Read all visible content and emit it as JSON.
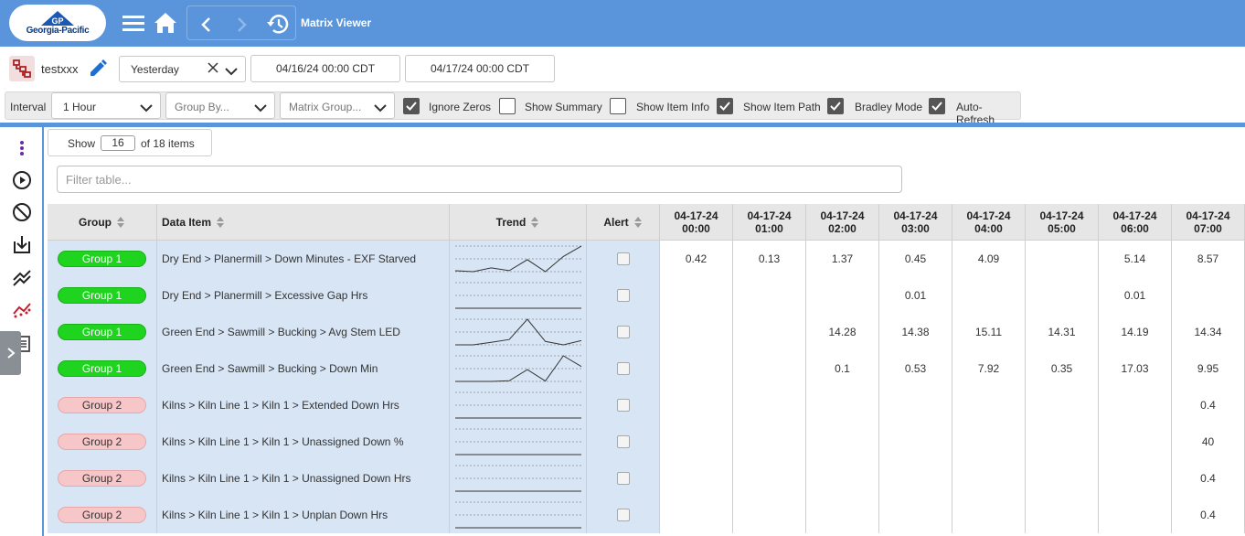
{
  "header": {
    "logo_text": "Georgia-Pacific",
    "logo_mark_text": "GP",
    "title": "Matrix Viewer",
    "icons": [
      "menu-icon",
      "home-icon",
      "back-icon",
      "forward-icon",
      "history-icon"
    ]
  },
  "report": {
    "name": "testxxx",
    "range_preset": "Yesterday",
    "start": "04/16/24 00:00 CDT",
    "end": "04/17/24 00:00 CDT"
  },
  "options": {
    "interval_label": "Interval",
    "interval_value": "1 Hour",
    "group_by_placeholder": "Group By...",
    "matrix_group_placeholder": "Matrix Group...",
    "checkboxes": [
      {
        "label": "Ignore Zeros",
        "checked": true
      },
      {
        "label": "Show Summary",
        "checked": false
      },
      {
        "label": "Show Item Info",
        "checked": false
      },
      {
        "label": "Show Item Path",
        "checked": true
      },
      {
        "label": "Bradley Mode",
        "checked": true
      },
      {
        "label": "Auto-Refresh",
        "checked": true
      }
    ]
  },
  "sidebar": {
    "icons": [
      "more-vertical-icon",
      "play-circle-icon",
      "block-icon",
      "download-icon",
      "trend-lines-icon",
      "scatter-trend-icon",
      "document-icon"
    ]
  },
  "table_controls": {
    "show_label": "Show",
    "page_size": "16",
    "of_label": "of 18 items",
    "filter_placeholder": "Filter table..."
  },
  "table": {
    "headers": {
      "group": "Group",
      "data_item": "Data Item",
      "trend": "Trend",
      "alert": "Alert",
      "times": [
        {
          "date": "04-17-24",
          "time": "00:00"
        },
        {
          "date": "04-17-24",
          "time": "01:00"
        },
        {
          "date": "04-17-24",
          "time": "02:00"
        },
        {
          "date": "04-17-24",
          "time": "03:00"
        },
        {
          "date": "04-17-24",
          "time": "04:00"
        },
        {
          "date": "04-17-24",
          "time": "05:00"
        },
        {
          "date": "04-17-24",
          "time": "06:00"
        },
        {
          "date": "04-17-24",
          "time": "07:00"
        }
      ]
    },
    "rows": [
      {
        "group": "Group 1",
        "group_class": "g1",
        "item": "Dry End > Planermill > Down Minutes - EXF Starved",
        "values": [
          "0.42",
          "0.13",
          "1.37",
          "0.45",
          "4.09",
          "",
          "5.14",
          "8.57"
        ]
      },
      {
        "group": "Group 1",
        "group_class": "g1",
        "item": "Dry End > Planermill > Excessive Gap Hrs",
        "values": [
          "",
          "",
          "",
          "0.01",
          "",
          "",
          "0.01",
          ""
        ]
      },
      {
        "group": "Group 1",
        "group_class": "g1",
        "item": "Green End > Sawmill > Bucking > Avg Stem LED",
        "values": [
          "",
          "",
          "14.28",
          "14.38",
          "15.11",
          "14.31",
          "14.19",
          "14.34"
        ]
      },
      {
        "group": "Group 1",
        "group_class": "g1",
        "item": "Green End > Sawmill > Bucking > Down Min",
        "values": [
          "",
          "",
          "0.1",
          "0.53",
          "7.92",
          "0.35",
          "17.03",
          "9.95"
        ]
      },
      {
        "group": "Group 2",
        "group_class": "g2",
        "item": "Kilns > Kiln Line 1 > Kiln 1 > Extended Down Hrs",
        "values": [
          "",
          "",
          "",
          "",
          "",
          "",
          "",
          "0.4"
        ]
      },
      {
        "group": "Group 2",
        "group_class": "g2",
        "item": "Kilns > Kiln Line 1 > Kiln 1 > Unassigned Down %",
        "values": [
          "",
          "",
          "",
          "",
          "",
          "",
          "",
          "40"
        ]
      },
      {
        "group": "Group 2",
        "group_class": "g2",
        "item": "Kilns > Kiln Line 1 > Kiln 1 > Unassigned Down Hrs",
        "values": [
          "",
          "",
          "",
          "",
          "",
          "",
          "",
          "0.4"
        ]
      },
      {
        "group": "Group 2",
        "group_class": "g2",
        "item": "Kilns > Kiln Line 1 > Kiln 1 > Unplan Down Hrs",
        "values": [
          "",
          "",
          "",
          "",
          "",
          "",
          "",
          "0.4"
        ]
      }
    ]
  }
}
